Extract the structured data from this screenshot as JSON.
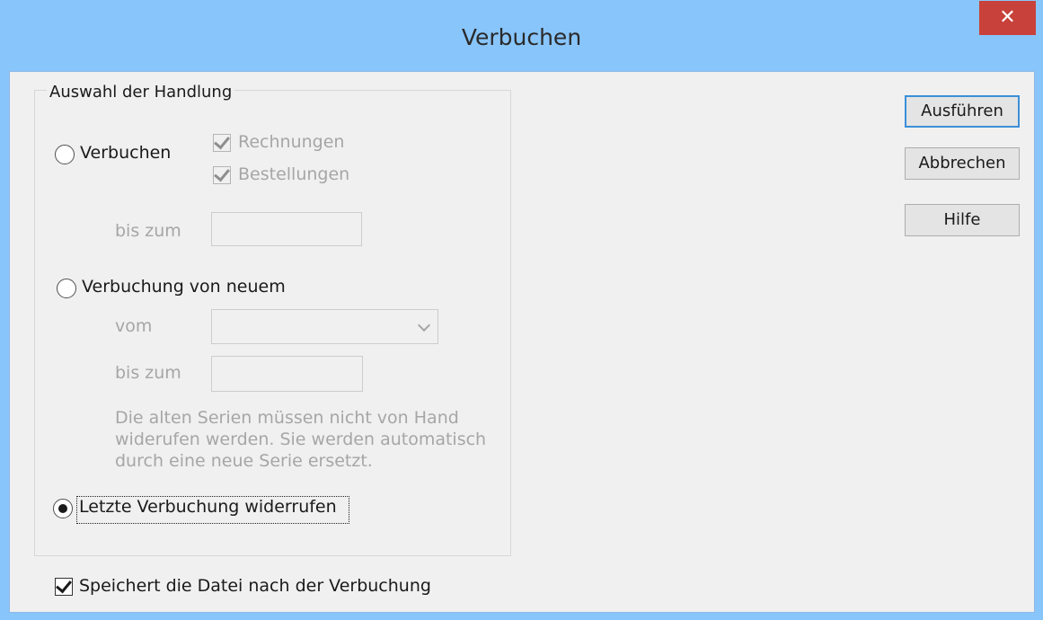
{
  "window": {
    "title": "Verbuchen",
    "close_glyph": "✕"
  },
  "group": {
    "title": "Auswahl der Handlung"
  },
  "options": {
    "verbuchen": {
      "label": "Verbuchen",
      "selected": false,
      "rechnungen": {
        "label": "Rechnungen",
        "checked": true
      },
      "bestellungen": {
        "label": "Bestellungen",
        "checked": true
      },
      "bis_zum_label": "bis zum",
      "bis_zum_value": ""
    },
    "neu": {
      "label": "Verbuchung von neuem",
      "selected": false,
      "vom_label": "vom",
      "vom_value": "",
      "bis_zum_label": "bis zum",
      "bis_zum_value": "",
      "note": "Die alten Serien müssen nicht von Hand widerufen werden. Sie werden automatisch durch eine neue Serie ersetzt."
    },
    "widerrufen": {
      "label": "Letzte Verbuchung widerrufen",
      "selected": true
    }
  },
  "save_checkbox": {
    "label": "Speichert die Datei nach der Verbuchung",
    "checked": true
  },
  "buttons": {
    "execute": "Ausführen",
    "cancel": "Abbrechen",
    "help": "Hilfe"
  },
  "colors": {
    "titlebar": "#88c5fb",
    "close": "#c8413a",
    "client": "#f0f0f0",
    "disabled_text": "#a6a6a6",
    "default_button_border": "#3b8fd8"
  },
  "icons": {
    "close": "close-icon",
    "combo": "chevron-down-icon",
    "check": "check-icon"
  }
}
